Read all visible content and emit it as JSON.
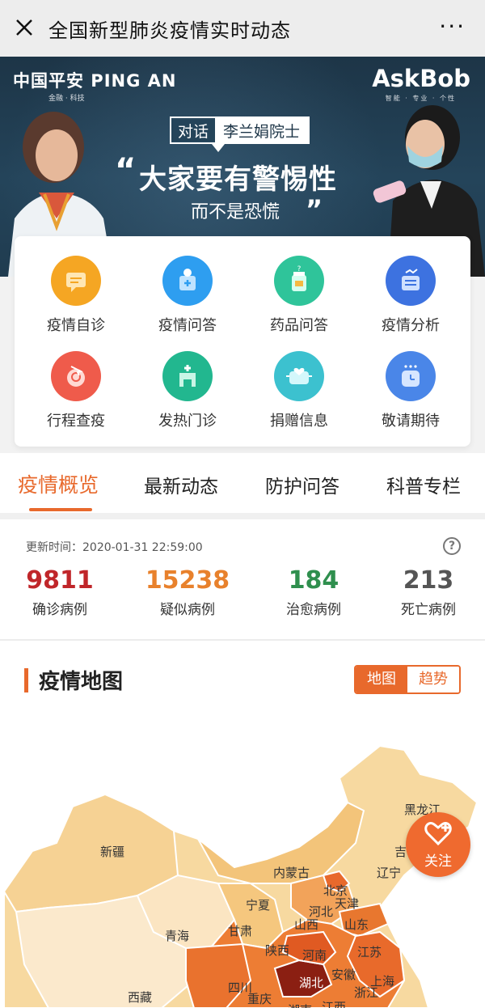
{
  "topbar": {
    "title": "全国新型肺炎疫情实时动态",
    "close_icon": "close-icon",
    "more_icon": "more-icon",
    "more_glyph": "···"
  },
  "banner": {
    "brand_left": "中国平安 PING AN",
    "brand_left_sub": "金融 · 科技",
    "brand_right": "AskBob",
    "brand_right_sub": "智能 · 专业 · 个性",
    "talk_label": "对话",
    "talk_name": "李兰娟院士",
    "quote_open": "“",
    "quote_main": "大家要有警惕性",
    "quote_sub": "而不是恐慌",
    "quote_close": "”"
  },
  "services": [
    {
      "label": "疫情自诊",
      "icon": "chat-icon",
      "color": "#f5a623"
    },
    {
      "label": "疫情问答",
      "icon": "lightbulb-icon",
      "color": "#2e9ef0"
    },
    {
      "label": "药品问答",
      "icon": "medicine-icon",
      "color": "#2fc49a"
    },
    {
      "label": "疫情分析",
      "icon": "analysis-icon",
      "color": "#3d72e0"
    },
    {
      "label": "行程查疫",
      "icon": "travel-icon",
      "color": "#ef5b4b"
    },
    {
      "label": "发热门诊",
      "icon": "clinic-icon",
      "color": "#22b78f"
    },
    {
      "label": "捐赠信息",
      "icon": "donation-icon",
      "color": "#3cc1cf"
    },
    {
      "label": "敬请期待",
      "icon": "alarm-icon",
      "color": "#4a86e8"
    }
  ],
  "tabs": [
    "疫情概览",
    "最新动态",
    "防护问答",
    "科普专栏"
  ],
  "stats": {
    "update_label": "更新时间：",
    "update_time": "2020-01-31 22:59:00",
    "help": "?",
    "items": [
      {
        "value": "9811",
        "label": "确诊病例",
        "color": "#c0262a"
      },
      {
        "value": "15238",
        "label": "疑似病例",
        "color": "#e8812c"
      },
      {
        "value": "184",
        "label": "治愈病例",
        "color": "#2f8f4e"
      },
      {
        "value": "213",
        "label": "死亡病例",
        "color": "#555555"
      }
    ]
  },
  "map": {
    "title": "疫情地图",
    "toggle_map": "地图",
    "toggle_trend": "趋势",
    "follow_label": "关注",
    "follow_icon": "heart-plus-icon",
    "provinces": [
      "黑龙江",
      "新疆",
      "吉",
      "内蒙古",
      "辽宁",
      "北京",
      "天津",
      "河北",
      "宁夏",
      "青海",
      "甘肃",
      "山西",
      "山东",
      "陕西",
      "河南",
      "江苏",
      "安徽",
      "上海",
      "四川",
      "重庆",
      "湖北",
      "浙江",
      "西藏",
      "湖南",
      "江西"
    ]
  }
}
